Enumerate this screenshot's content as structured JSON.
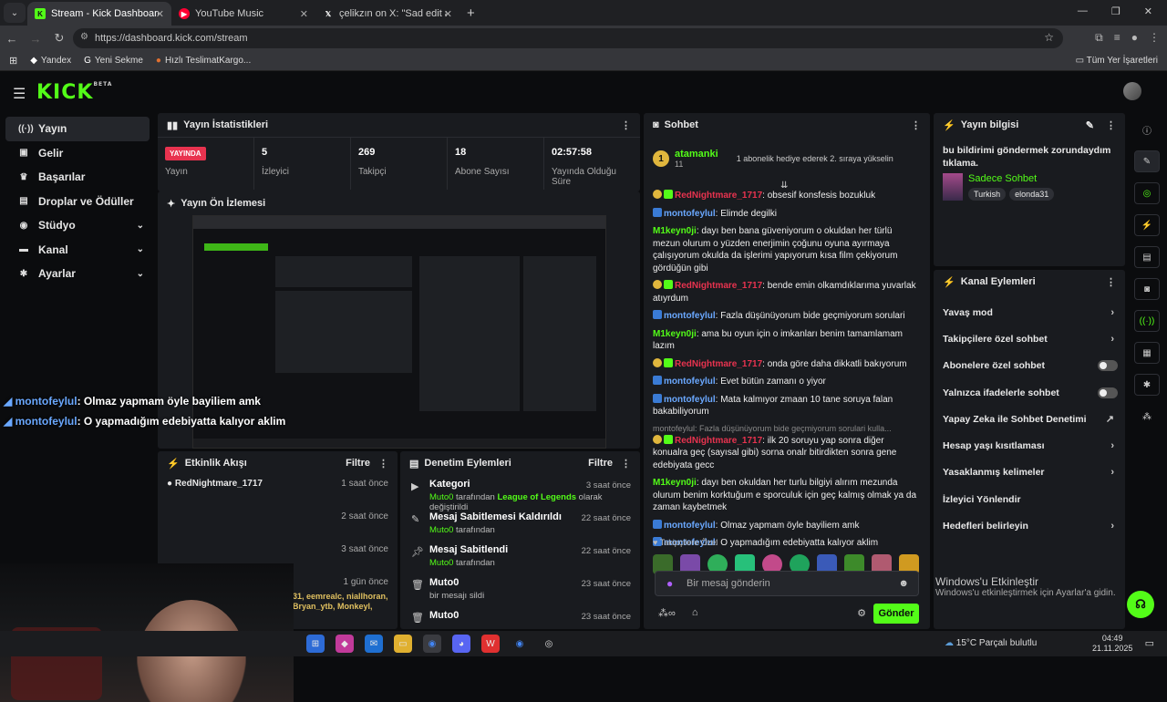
{
  "browser": {
    "tabs": [
      {
        "title": "Stream - Kick Dashboard",
        "active": true
      },
      {
        "title": "YouTube Music",
        "active": false
      },
      {
        "title": "çelikzın on X: \"Sad edit atar ma",
        "active": false
      }
    ],
    "url": "https://dashboard.kick.com/stream",
    "bookmarks": [
      "Yandex",
      "Yeni Sekme",
      "Hızlı TeslimatKargo..."
    ],
    "bookmarks_right": "Tüm Yer İşaretleri"
  },
  "sidebar": {
    "items": [
      {
        "label": "Yayın",
        "icon": "broadcast-icon"
      },
      {
        "label": "Gelir",
        "icon": "revenue-icon"
      },
      {
        "label": "Başarılar",
        "icon": "trophy-icon"
      },
      {
        "label": "Droplar ve Ödüller",
        "icon": "gift-icon"
      },
      {
        "label": "Stüdyo",
        "icon": "studio-icon"
      },
      {
        "label": "Kanal",
        "icon": "channel-icon"
      },
      {
        "label": "Ayarlar",
        "icon": "gear-icon"
      }
    ]
  },
  "stats": {
    "title": "Yayın İstatistikleri",
    "live_badge": "YAYINDA",
    "live_label": "Yayın",
    "items": [
      {
        "value": "5",
        "label": "İzleyici"
      },
      {
        "value": "269",
        "label": "Takipçi"
      },
      {
        "value": "18",
        "label": "Abone Sayısı"
      },
      {
        "value": "02:57:58",
        "label": "Yayında Olduğu Süre"
      }
    ]
  },
  "preview": {
    "title": "Yayın Ön İzlemesi",
    "overlay": [
      {
        "user": "montofeylul",
        "text": ": Olmaz yapmam öyle bayiliem amk"
      },
      {
        "user": "montofeylul",
        "text": ": O yapmadığım edebiyatta kalıyor aklim"
      }
    ]
  },
  "activity": {
    "title": "Etkinlik Akışı",
    "filter": "Filtre",
    "rows": [
      {
        "name": "RedNightmare_1717",
        "time": "1 saat önce"
      },
      {
        "name": "",
        "time": "2 saat önce"
      },
      {
        "name": "",
        "time": "3 saat önce"
      },
      {
        "name": "",
        "time": "1 gün önce"
      }
    ],
    "names_line1": "31, eemrealc, niallhoran,",
    "names_line2": "Bryan_ytb, Monkeyl,"
  },
  "moderation": {
    "title": "Denetim Eylemleri",
    "filter": "Filtre",
    "rows": [
      {
        "title": "Kategori",
        "time": "3 saat önce",
        "user": "Muto0",
        "mid": " tarafından ",
        "target": "League of Legends",
        "tail": " olarak değiştirildi"
      },
      {
        "title": "Mesaj Sabitlemesi Kaldırıldı",
        "time": "22 saat önce",
        "user": "Muto0",
        "mid": " tarafından",
        "target": "",
        "tail": ""
      },
      {
        "title": "Mesaj Sabitlendi",
        "time": "22 saat önce",
        "user": "Muto0",
        "mid": " tarafından",
        "target": "",
        "tail": ""
      },
      {
        "title": "Muto0",
        "time": "23 saat önce",
        "user": "",
        "mid": "bir mesajı sildi",
        "target": "",
        "tail": ""
      },
      {
        "title": "Muto0",
        "time": "23 saat önce",
        "user": "",
        "mid": "",
        "target": "",
        "tail": ""
      }
    ]
  },
  "chat": {
    "title": "Sohbet",
    "gift_user": "atamanki",
    "gift_count": "11",
    "gift_text": "1 abonelik hediye ederek 2. sıraya yükselin",
    "messages": [
      {
        "user": "RedNightmare_1717",
        "color": "red",
        "text": ": obsesif konsfesis bozukluk"
      },
      {
        "user": "montofeylul",
        "color": "blue",
        "text": ": Elimde degilki"
      },
      {
        "user": "M1keyn0ji",
        "color": "green",
        "text": ": dayı ben bana güveniyorum o okuldan her türlü mezun olurum o yüzden enerjimin çoğunu oyuna ayırmaya çalışıyorum okulda da işlerimi yapıyorum kısa film çekiyorum gördüğün gibi"
      },
      {
        "user": "RedNightmare_1717",
        "color": "red",
        "text": ": bende emin olkamdıklarıma yuvarlak atıyrdum"
      },
      {
        "user": "montofeylul",
        "color": "blue",
        "text": ": Fazla düşünüyorum bide geçmiyorum sorulari"
      },
      {
        "user": "M1keyn0ji",
        "color": "green",
        "text": ": ama bu oyun için o imkanları benim tamamlamam lazım"
      },
      {
        "user": "RedNightmare_1717",
        "color": "red",
        "text": ": onda göre daha dikkatli bakıyorum"
      },
      {
        "user": "montofeylul",
        "color": "blue",
        "text": ": Evet bütün zamanı o yiyor"
      },
      {
        "user": "montofeylul",
        "color": "blue",
        "text": ": Mata kalmıyor zmaan 10 tane soruya falan bakabiliyorum"
      },
      {
        "user": "RedNightmare_1717",
        "color": "red",
        "text": ": ilk 20 soruyu yap sonra diğer konualra geç (sayısal gibi) sorna onalr bitirdikten sonra gene edebiyata gecc"
      },
      {
        "user": "M1keyn0ji",
        "color": "green",
        "text": ": dayı ben okuldan her turlu bilgiyi alırım mezunda olurum benim korktuğum e sporculuk için geç kalmış olmak ya da zaman kaybetmek"
      },
      {
        "user": "montofeylul",
        "color": "blue",
        "text": ": Olmaz yapmam öyle bayiliem amk"
      },
      {
        "user": "montofeylul",
        "color": "blue",
        "text": ": O yapmadığım edebiyatta kalıyor aklim"
      }
    ],
    "reply_hint": "montofeylul: Fazla düşünüyorum bide geçmiyorum sorulari kulla...",
    "follower_only": "Takipçilere Özel",
    "input_placeholder": "Bir mesaj gönderin",
    "send": "Gönder"
  },
  "info": {
    "title": "Yayın bilgisi",
    "stream_title": "bu bildirimi göndermek zorundaydım tıklama.",
    "category": "Sadece Sohbet",
    "tags": [
      "Turkish",
      "elonda31"
    ]
  },
  "channel_actions": {
    "title": "Kanal Eylemleri",
    "items": [
      {
        "label": "Yavaş mod",
        "kind": "arrow"
      },
      {
        "label": "Takipçilere özel sohbet",
        "kind": "arrow"
      },
      {
        "label": "Abonelere özel sohbet",
        "kind": "toggle"
      },
      {
        "label": "Yalnızca ifadelerle sohbet",
        "kind": "toggle"
      },
      {
        "label": "Yapay Zeka ile Sohbet Denetimi",
        "kind": "external"
      },
      {
        "label": "Hesap yaşı kısıtlaması",
        "kind": "arrow"
      },
      {
        "label": "Yasaklanmış kelimeler",
        "kind": "arrow"
      },
      {
        "label": "İzleyici Yönlendir",
        "kind": "none"
      },
      {
        "label": "Hedefleri belirleyin",
        "kind": "arrow"
      }
    ]
  },
  "windows": {
    "activate_title": "Windows'u Etkinleştir",
    "activate_sub": "Windows'u etkinleştirmek için Ayarlar'a gidin.",
    "weather": "15°C  Parçalı bulutlu",
    "time": "04:49",
    "date": "21.11.2025"
  },
  "colors": {
    "accent": "#53fc18",
    "live": "#e8334f",
    "panel": "#191b1f"
  }
}
